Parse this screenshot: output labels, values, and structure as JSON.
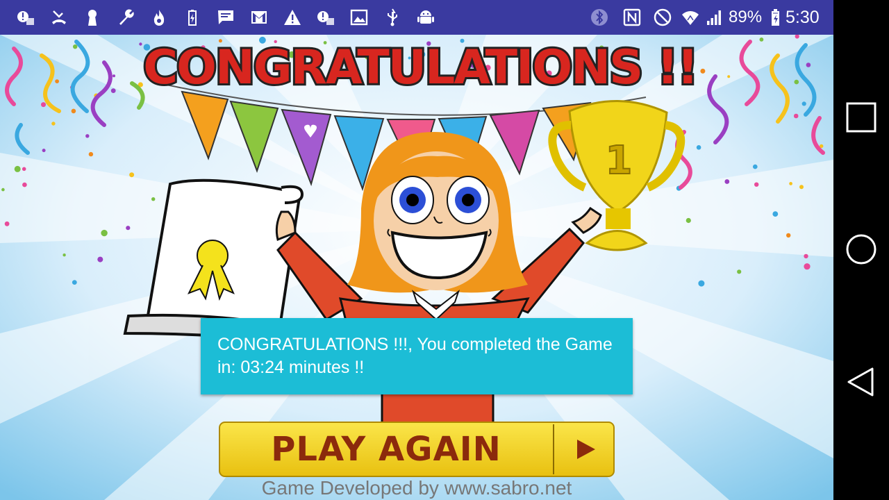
{
  "status_bar": {
    "left_icons": [
      "photo-alert-icon",
      "missed-call-icon",
      "keyhole-icon",
      "wrench-icon",
      "flame-icon",
      "battery-charge-icon",
      "message-icon",
      "gmail-icon",
      "warning-icon",
      "photo-alert-icon",
      "image-icon",
      "usb-icon",
      "android-debug-icon"
    ],
    "right_icons": [
      "bluetooth-icon",
      "nfc-icon",
      "do-not-disturb-icon",
      "wifi-icon",
      "signal-icon",
      "battery-icon"
    ],
    "battery_percent": "89%",
    "time": "5:30",
    "background_color": "#3a3aa0"
  },
  "game": {
    "banner_title": "CONGRATULATIONS !!",
    "trophy_number": "1",
    "toast_message": "CONGRATULATIONS !!!, You completed the Game in: 03:24 minutes !!",
    "play_again_label": "PLAY AGAIN",
    "developer_credit": "Game Developed by www.sabro.net",
    "toast_color": "#1cbdd6",
    "button_color": "#f3d51a"
  },
  "nav_bar": {
    "buttons": [
      "recents-icon",
      "home-icon",
      "back-icon"
    ]
  }
}
